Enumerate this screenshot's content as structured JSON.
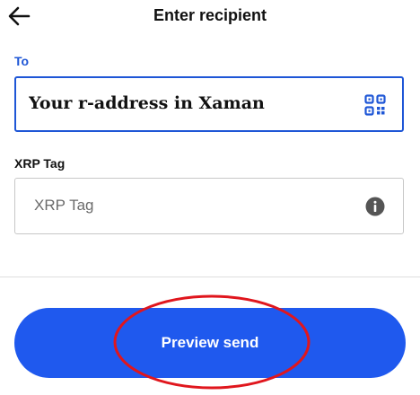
{
  "header": {
    "title": "Enter recipient",
    "back_icon": "arrow-left-icon"
  },
  "recipient": {
    "label": "To",
    "value": "Your r-address in Xaman",
    "qr_icon": "qr-code-icon"
  },
  "tag": {
    "label": "XRP Tag",
    "placeholder": "XRP Tag",
    "info_icon": "info-icon"
  },
  "actions": {
    "preview_label": "Preview send"
  },
  "colors": {
    "accent": "#1e56d6",
    "button": "#1f59ee",
    "annotation": "#e0161d"
  }
}
